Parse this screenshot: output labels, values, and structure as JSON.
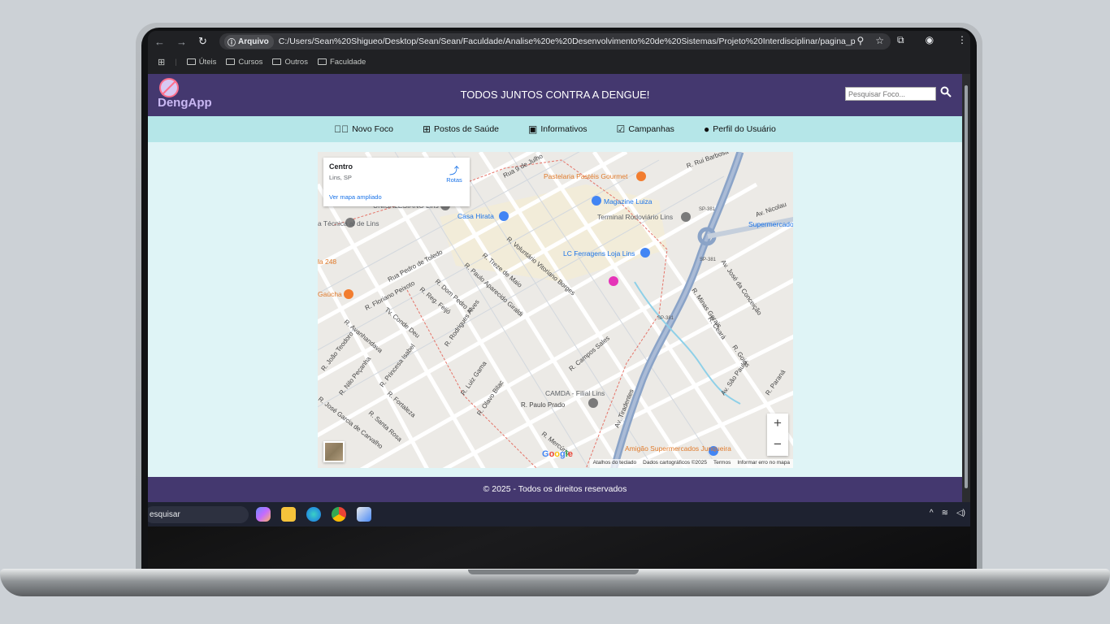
{
  "browser": {
    "chip_label": "Arquivo",
    "url": "C:/Users/Sean%20Shigueo/Desktop/Sean/Sean/Faculdade/Analise%20e%20Desenvolvimento%20de%20Sistemas/Projeto%20Interdisciplinar/pagina_projeto/...",
    "bookmarks": [
      "Úteis",
      "Cursos",
      "Outros",
      "Faculdade"
    ]
  },
  "site": {
    "logo_text": "DengApp",
    "title": "TODOS JUNTOS CONTRA A DENGUE!",
    "search_placeholder": "Pesquisar Foco..."
  },
  "nav": {
    "items": [
      {
        "label": "Novo Foco",
        "icon": "check-circle-plus-icon"
      },
      {
        "label": "Postos de Saúde",
        "icon": "medical-plus-icon"
      },
      {
        "label": "Informativos",
        "icon": "medkit-icon"
      },
      {
        "label": "Campanhas",
        "icon": "calendar-check-icon"
      },
      {
        "label": "Perfil do Usuário",
        "icon": "user-icon"
      }
    ]
  },
  "map": {
    "place_title": "Centro",
    "place_subtitle": "Lins, SP",
    "directions_label": "Rotas",
    "enlarged_link": "Ver mapa ampliado",
    "zoom_in": "+",
    "zoom_out": "−",
    "attribution": [
      "Atalhos do teclado",
      "Dados cartográficos ©2025",
      "Termos",
      "Informar erro no mapa"
    ],
    "labels": {
      "pastelaria": "Pastelaria Pastéis Gourmet",
      "magazine": "Magazine Luiza",
      "terminal": "Terminal Rodoviário Lins",
      "casa_hirata": "Casa Hirata",
      "unisalesiano": "UNISALESIANO Lins",
      "lc": "LC Ferragens Loja Lins",
      "supermercado": "Supermercado Lins P",
      "camda": "CAMDA - Filial Lins",
      "amigao": "Amigão Supermercados Junqueira",
      "gaucha": "Gaúcha",
      "tecnica": "a Técnica al de Lins",
      "r248": "la 248",
      "sp381": "SP-381",
      "streets": [
        "Rua Pedro de Toledo",
        "R. Floriano Peixoto",
        "R. Voluntário Vitoriano Borges",
        "R. Treze de Maio",
        "R. Paulo Aparecido Giraldi",
        "R. Dom Pedro II",
        "Av. Tiradentes",
        "R. Campos Sales",
        "R. Rodrigues Alves",
        "R. Luiz Gama",
        "R. Paulo Prado",
        "R. Princesa Isabel",
        "R. Nilo Peçanha",
        "R. João Teodoro",
        "R. Avanhandava",
        "Tv. Conde Deu",
        "R. Reg. Feijó",
        "Av. José da Conceição",
        "R. Minas Gerais",
        "R. Goiás",
        "R. Ceará",
        "Av. São Paulo",
        "R. Paraná",
        "Av. Nicolau",
        "R. Rui Barbosa",
        "Rua 9 de Julho",
        "R. Fortaleza",
        "R. Santa Rosa",
        "R. José Garcia de Carvalho",
        "R. Olavo Bilac",
        "R. Mercúrio"
      ]
    }
  },
  "footer": {
    "text": "© 2025 - Todos os direitos reservados"
  },
  "taskbar": {
    "search_text": "esquisar"
  },
  "colors": {
    "header": "#44386f",
    "nav": "#b5e6e8",
    "page": "#dff4f6"
  }
}
